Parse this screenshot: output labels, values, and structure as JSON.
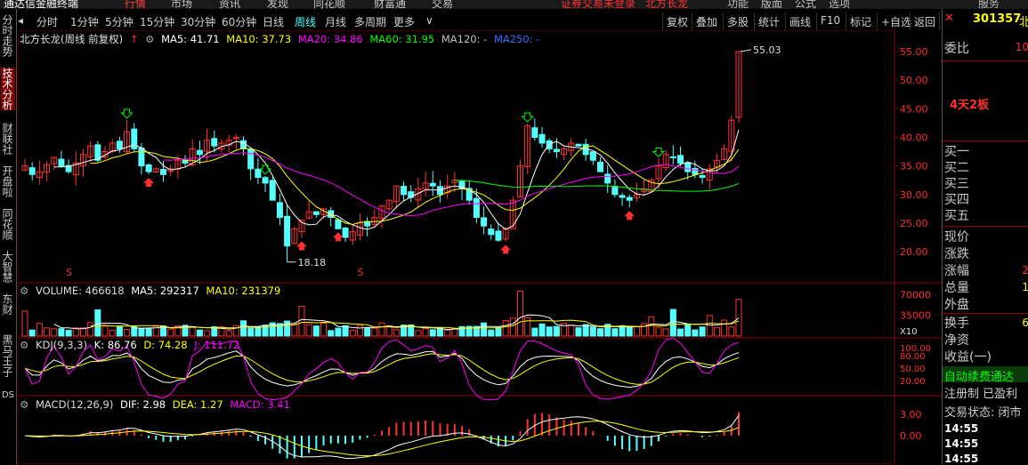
{
  "window": {
    "title": "通达信金融终端",
    "stock_code": "301357",
    "stock_name_short": "北"
  },
  "top_menu": [
    "行情",
    "市场",
    "资讯",
    "发现",
    "同花顺",
    "财富通",
    "交易"
  ],
  "top_notice": "证券交易未登录",
  "top_stock": "北方长龙",
  "right_top": [
    "功能",
    "版面",
    "公式",
    "选项",
    "服务"
  ],
  "period_tabs": [
    "分时",
    "1分钟",
    "5分钟",
    "15分钟",
    "30分钟",
    "60分钟",
    "日线",
    "周线",
    "月线",
    "多周期",
    "更多"
  ],
  "active_period": "周线",
  "toolbar_right": [
    "复权",
    "叠加",
    "多股",
    "统计",
    "画线",
    "F10",
    "标记",
    "+自选",
    "返回"
  ],
  "left_tabs": [
    "分时走势",
    "技术分析",
    "财联社",
    "开盘啦",
    "同花顺",
    "大智慧",
    "东财",
    "黑马王子",
    "DS"
  ],
  "main_info": {
    "title": "北方长龙(周线 前复权)",
    "ma5": "MA5: 41.71",
    "ma10": "MA10: 37.73",
    "ma20": "MA20: 34.86",
    "ma60": "MA60: 31.95",
    "ma120": "MA120: -",
    "ma250": "MA250: -"
  },
  "vol_info": {
    "vol": "VOLUME: 466618",
    "ma5": "MA5: 292317",
    "ma10": "MA10: 231379"
  },
  "kdj_info": {
    "name": "KDJ(9,3,3)",
    "k": "K: 86.76",
    "d": "D: 74.28",
    "j": "J: 111.72"
  },
  "macd_info": {
    "name": "MACD(12,26,9)",
    "dif": "DIF: 2.98",
    "dea": "DEA: 1.27",
    "macd": "MACD: 3.41"
  },
  "annotations": {
    "high": "55.03",
    "low": "18.18",
    "label": "4天2板",
    "ds": "DS",
    "x10": "X10",
    "s_mark": "S"
  },
  "price_axis": [
    "55.00",
    "50.00",
    "45.00",
    "40.00",
    "35.00",
    "30.00",
    "25.00",
    "20.00"
  ],
  "vol_axis": [
    "70000",
    "35000"
  ],
  "kdj_axis": [
    "100.00",
    "80.00",
    "50.00",
    "20.00"
  ],
  "macd_axis": [
    "3.00",
    "0.00"
  ],
  "right_panel": {
    "labels": [
      "委比",
      "买一",
      "买二",
      "买三",
      "买四",
      "买五",
      "现价",
      "涨跌",
      "涨幅",
      "总量",
      "外盘",
      "换手",
      "净资",
      "收益(一)"
    ],
    "weibi_val": "10",
    "zhangfu_val": "2",
    "zongliang_val": "1",
    "huanshou_val": "6",
    "marquee": "自动续费通达",
    "reg": "注册制 已盈利",
    "trade_status": "交易状态: 闭市",
    "times": [
      "14:55",
      "14:55",
      "14:55"
    ]
  },
  "colors": {
    "up": "#ff3232",
    "down": "#54ffff",
    "ma5": "#ffffff",
    "ma10": "#ffff00",
    "ma20": "#ff00ff",
    "ma60": "#00ff00",
    "ma250": "#3070ff",
    "grid": "#8b0000"
  },
  "chart_data": {
    "type": "candlestick",
    "title": "北方长龙(周线 前复权)",
    "price_range": [
      18.18,
      55.03
    ],
    "close": [
      35.0,
      33.5,
      34.0,
      35.2,
      36.5,
      35.0,
      34.0,
      35.5,
      37.0,
      38.5,
      36.0,
      37.5,
      39.0,
      38.0,
      41.0,
      38.0,
      35.0,
      34.0,
      34.5,
      33.5,
      34.5,
      36.0,
      35.5,
      38.0,
      37.0,
      39.5,
      38.5,
      39.0,
      39.5,
      40.0,
      38.0,
      34.5,
      33.0,
      32.0,
      29.0,
      26.0,
      21.0,
      24.0,
      25.5,
      27.0,
      26.5,
      27.5,
      26.0,
      24.0,
      22.5,
      23.5,
      25.0,
      24.5,
      26.0,
      28.0,
      29.0,
      31.5,
      30.0,
      29.5,
      31.0,
      32.0,
      31.5,
      30.0,
      31.5,
      32.5,
      31.0,
      29.0,
      26.0,
      24.5,
      23.0,
      22.0,
      24.0,
      29.0,
      35.0,
      42.0,
      40.0,
      39.0,
      38.0,
      37.5,
      38.0,
      39.0,
      38.5,
      37.0,
      36.0,
      34.0,
      32.0,
      30.0,
      29.5,
      29.0,
      30.0,
      31.0,
      32.5,
      35.0,
      37.0,
      36.5,
      35.5,
      34.0,
      33.5,
      33.0,
      34.5,
      36.0,
      38.0,
      43.0,
      55.03
    ],
    "volume_max": 70000,
    "kdj": {
      "k": 86.76,
      "d": 74.28,
      "j": 111.72
    },
    "macd": {
      "dif": 2.98,
      "dea": 1.27,
      "macd": 3.41
    }
  }
}
